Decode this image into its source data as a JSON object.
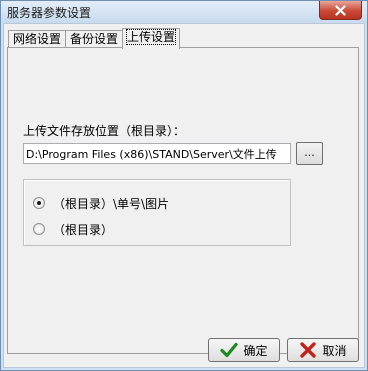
{
  "window": {
    "title": "服务器参数设置"
  },
  "tabs": [
    {
      "label": "网络设置"
    },
    {
      "label": "备份设置"
    },
    {
      "label": "上传设置"
    }
  ],
  "upload": {
    "path_label": "上传文件存放位置（根目录）：",
    "path_value": "D:\\Program Files (x86)\\STAND\\Server\\文件上传",
    "browse_label": "...",
    "options": [
      {
        "label": "（根目录）\\单号\\图片",
        "checked": true
      },
      {
        "label": "（根目录）",
        "checked": false
      }
    ]
  },
  "footer": {
    "ok_label": "确定",
    "cancel_label": "取消"
  },
  "colors": {
    "ok_icon": "#1e8a1e",
    "cancel_icon": "#c0231a",
    "close_button": "#c94a36"
  }
}
